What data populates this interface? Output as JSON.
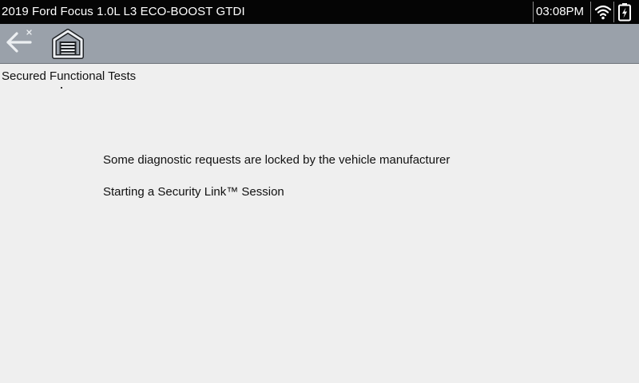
{
  "status_bar": {
    "vehicle_title": "2019 Ford Focus 1.0L L3 ECO-BOOST GTDI",
    "time": "03:08PM",
    "wifi_icon": "wifi-icon",
    "battery_icon": "battery-charging-icon"
  },
  "toolbar": {
    "back_icon": "back-arrow-icon",
    "home_icon": "garage-home-icon"
  },
  "page": {
    "title": "Secured Functional Tests"
  },
  "messages": [
    "Some diagnostic requests are locked by the vehicle manufacturer",
    "Starting a Security Link™ Session"
  ],
  "colors": {
    "status_bar_bg": "#050505",
    "toolbar_bg": "#9aa1aa",
    "content_bg": "#efefef",
    "icon_light": "#eceff2"
  }
}
